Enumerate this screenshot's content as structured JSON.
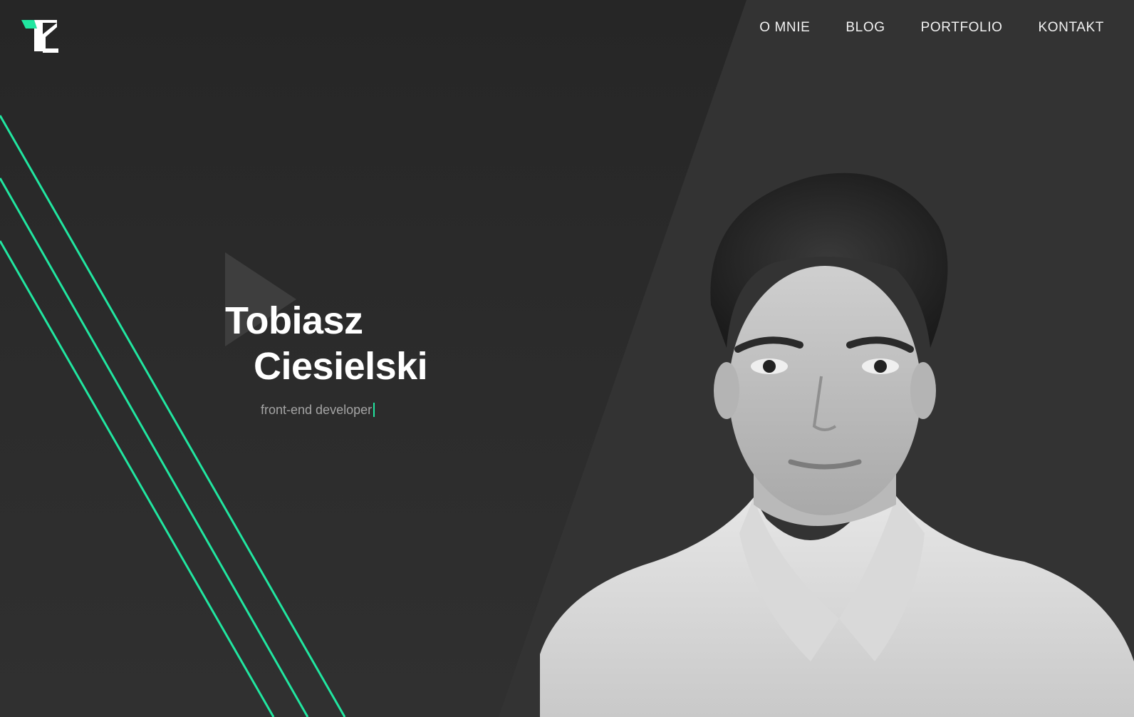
{
  "logo": {
    "icon": "tc-monogram-logo",
    "colors": {
      "accent": "#21e6a0",
      "letter": "#ffffff"
    }
  },
  "nav": {
    "items": [
      {
        "label": "O MNIE"
      },
      {
        "label": "BLOG"
      },
      {
        "label": "PORTFOLIO"
      },
      {
        "label": "KONTAKT"
      }
    ]
  },
  "hero": {
    "first_name": "Tobiasz",
    "last_name": "Ciesielski",
    "role": "front-end developer",
    "play_icon": "play-triangle-icon"
  },
  "portrait": {
    "description_icon": "person-portrait-photo"
  },
  "colors": {
    "background": "#2b2b2b",
    "panel": "#333333",
    "accent": "#21e6a0",
    "text": "#ffffff",
    "muted": "#a4a4a4"
  }
}
